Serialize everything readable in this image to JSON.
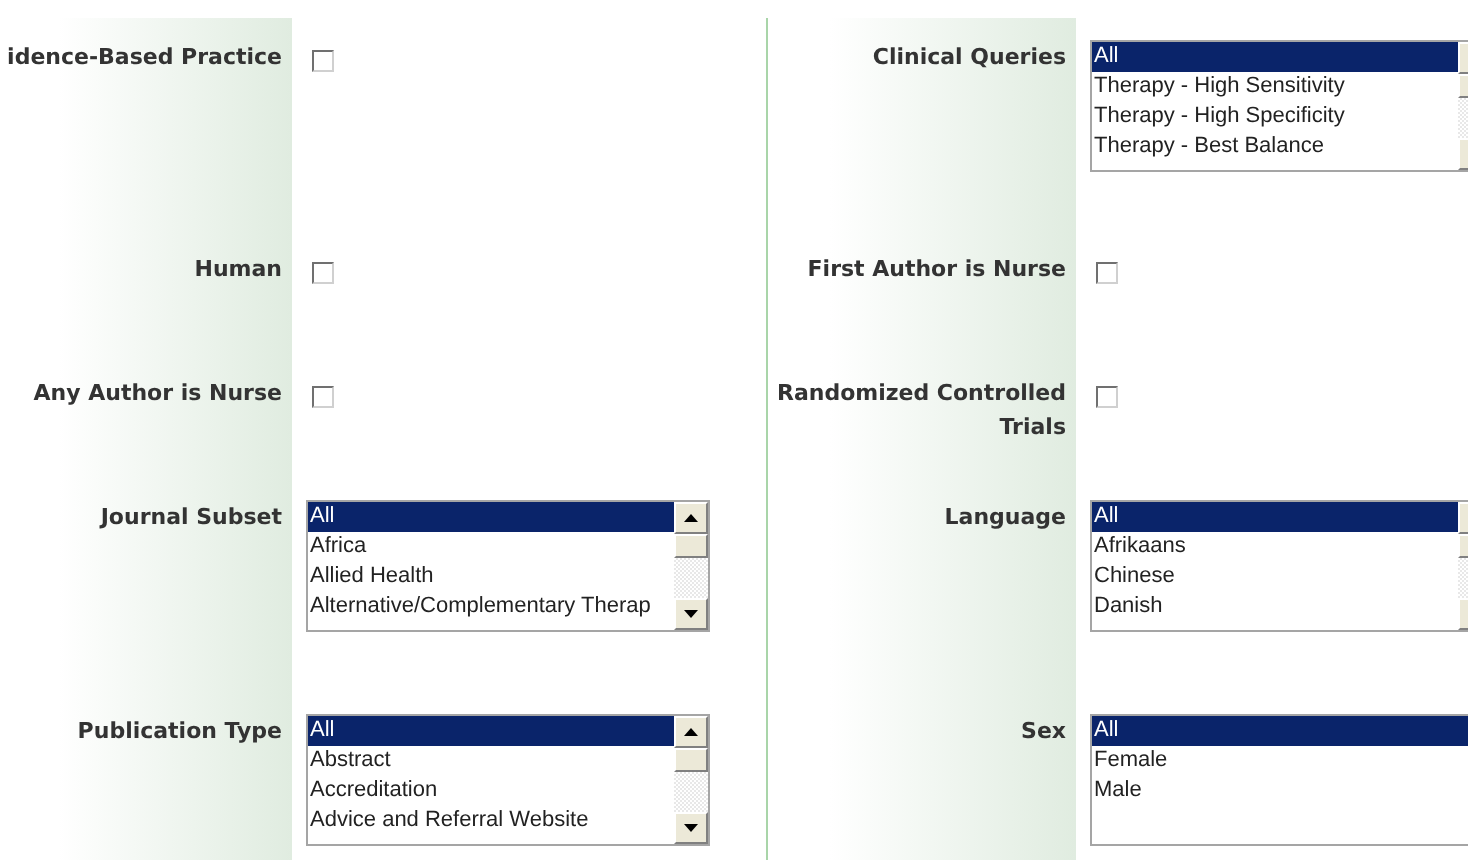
{
  "columns": [
    {
      "rows": [
        {
          "kind": "checkbox",
          "label": "idence-Based Practice",
          "checked": false
        },
        {
          "kind": "checkbox",
          "label": "Human",
          "checked": false
        },
        {
          "kind": "checkbox",
          "label": "Any Author is Nurse",
          "checked": false
        },
        {
          "kind": "listbox",
          "label": "Journal Subset",
          "options": [
            {
              "text": "All",
              "selected": true
            },
            {
              "text": "Africa",
              "selected": false
            },
            {
              "text": "Allied Health",
              "selected": false
            },
            {
              "text": "Alternative/Complementary Therap",
              "selected": false
            }
          ]
        },
        {
          "kind": "listbox",
          "label": "Publication Type",
          "options": [
            {
              "text": "All",
              "selected": true
            },
            {
              "text": "Abstract",
              "selected": false
            },
            {
              "text": "Accreditation",
              "selected": false
            },
            {
              "text": "Advice and Referral Website",
              "selected": false
            }
          ]
        }
      ]
    },
    {
      "rows": [
        {
          "kind": "listbox",
          "label": "Clinical Queries",
          "options": [
            {
              "text": "All",
              "selected": true
            },
            {
              "text": "Therapy - High Sensitivity",
              "selected": false
            },
            {
              "text": "Therapy - High Specificity",
              "selected": false
            },
            {
              "text": "Therapy - Best Balance",
              "selected": false
            }
          ]
        },
        {
          "kind": "checkbox",
          "label": "First Author is Nurse",
          "checked": false
        },
        {
          "kind": "checkbox",
          "label": "Randomized Controlled Trials",
          "checked": false
        },
        {
          "kind": "listbox",
          "label": "Language",
          "options": [
            {
              "text": "All",
              "selected": true
            },
            {
              "text": "Afrikaans",
              "selected": false
            },
            {
              "text": "Chinese",
              "selected": false
            },
            {
              "text": "Danish",
              "selected": false
            }
          ]
        },
        {
          "kind": "listbox",
          "label": "Sex",
          "options": [
            {
              "text": "All",
              "selected": true
            },
            {
              "text": "Female",
              "selected": false
            },
            {
              "text": "Male",
              "selected": false
            }
          ]
        }
      ]
    }
  ]
}
